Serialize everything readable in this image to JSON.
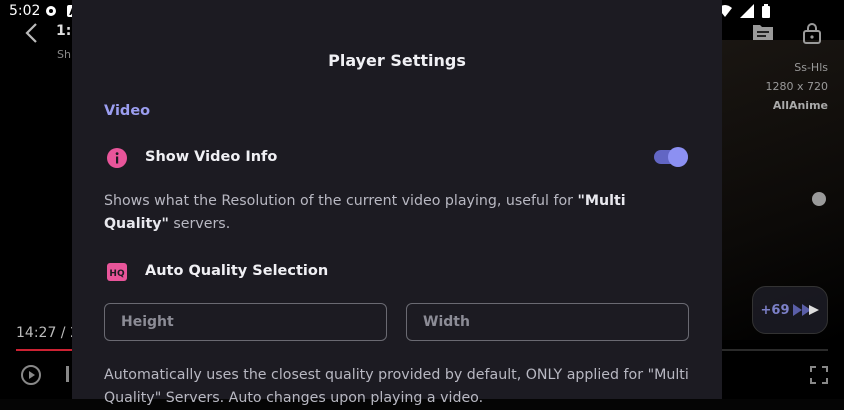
{
  "status_bar": {
    "time": "5:02"
  },
  "player": {
    "episode_title": "1:",
    "episode_sub": "Sh",
    "server_name": "Ss-Hls",
    "resolution": "1280 x 720",
    "brand": "AllAnime",
    "skip_label": "+69",
    "current_time": "14:27 / 2",
    "progress_fraction": 0.07
  },
  "settings": {
    "title": "Player Settings",
    "section": "Video",
    "show_video_info": {
      "label": "Show Video Info",
      "enabled": true,
      "desc_before": "Shows what the Resolution of the current video playing, useful for ",
      "desc_bold": "\"Multi Quality\"",
      "desc_after": " servers."
    },
    "auto_quality": {
      "label": "Auto Quality Selection",
      "height_placeholder": "Height",
      "width_placeholder": "Width",
      "desc": "Automatically uses the closest quality provided by default, ONLY applied for \"Multi Quality\" Servers. Auto changes upon playing a video."
    }
  },
  "colors": {
    "accent": "#9b9ef0",
    "icon_pink": "#e8559a",
    "sheet_bg": "#1c1b22"
  }
}
